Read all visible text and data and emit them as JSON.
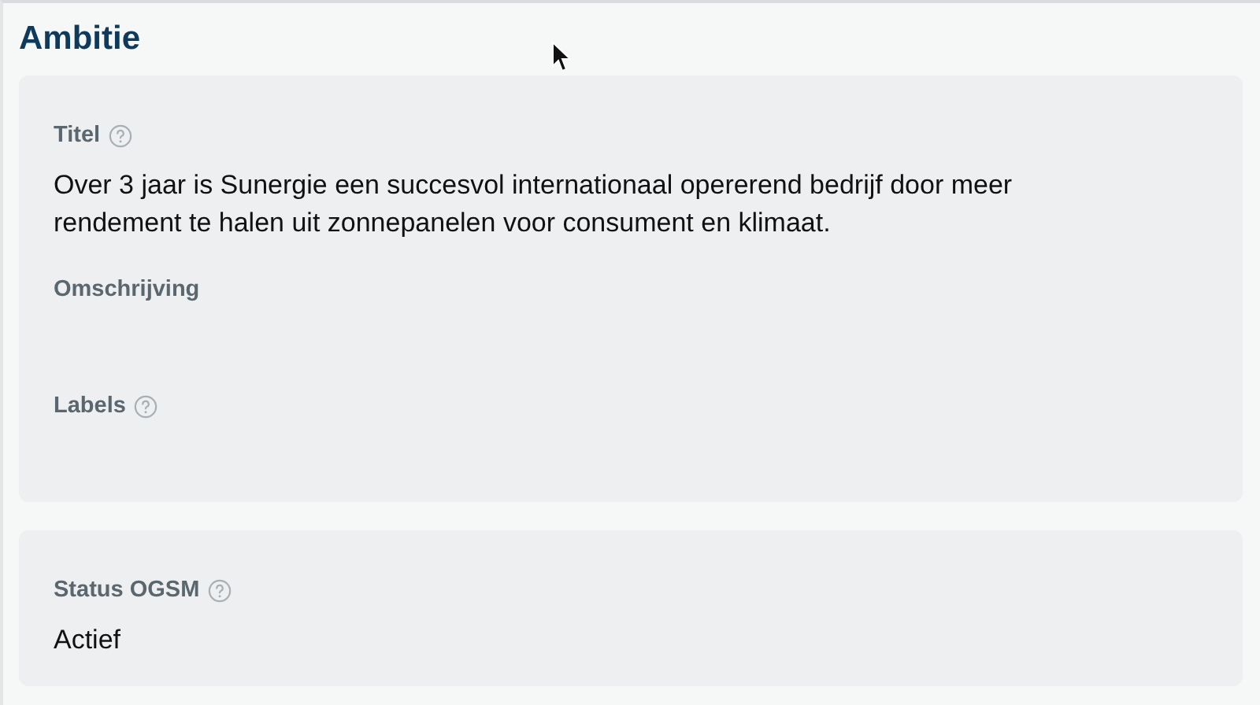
{
  "title": "Ambitie",
  "cards": [
    {
      "fields": [
        {
          "label": "Titel",
          "help": true,
          "value": "Over 3 jaar is Sunergie een succesvol internationaal opererend bedrijf door meer rendement te halen uit zonnepanelen voor consument en klimaat."
        },
        {
          "label": "Omschrijving",
          "help": false
        },
        {
          "label": "Labels",
          "help": true
        }
      ]
    },
    {
      "fields": [
        {
          "label": "Status OGSM",
          "help": true,
          "value": "Actief"
        }
      ]
    }
  ]
}
